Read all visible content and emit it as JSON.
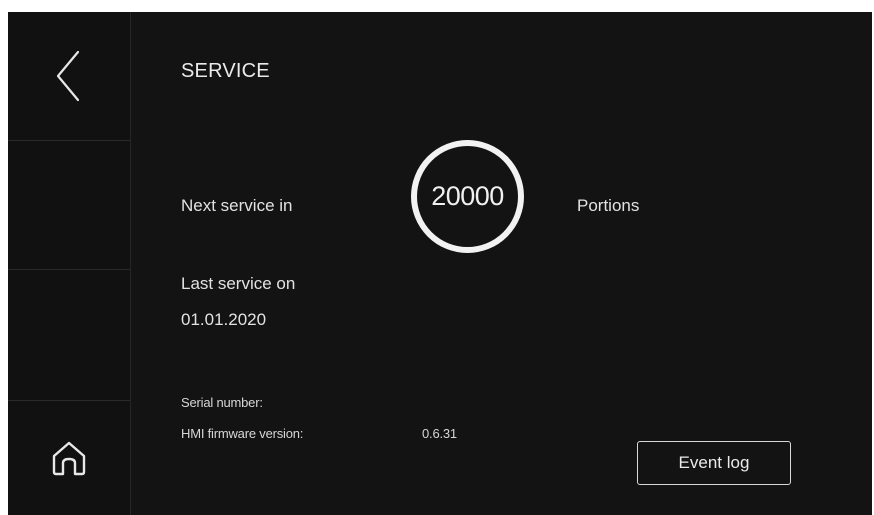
{
  "header": {
    "title": "SERVICE"
  },
  "sidebar": {
    "back_icon": "chevron-left-icon",
    "home_icon": "home-icon"
  },
  "service": {
    "next_label": "Next service in",
    "next_value": "20000",
    "next_unit": "Portions",
    "last_label": "Last service on",
    "last_date": "01.01.2020"
  },
  "info": {
    "serial_label": "Serial number:",
    "serial_value": "",
    "firmware_label": "HMI firmware version:",
    "firmware_value": "0.6.31"
  },
  "actions": {
    "event_log_label": "Event log"
  },
  "colors": {
    "background": "#131313",
    "sidebar": "#111111",
    "text": "#e6e6e6",
    "ring": "#f2f2f2"
  }
}
